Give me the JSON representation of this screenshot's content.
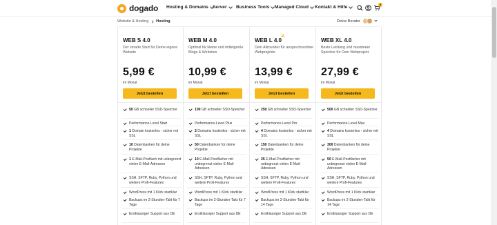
{
  "header": {
    "logo_text": "dogado",
    "nav": [
      {
        "label": "Hosting & Domains"
      },
      {
        "label": "Server"
      },
      {
        "label": "Business Tools"
      },
      {
        "label": "Managed Cloud"
      },
      {
        "label": "Kontakt & Hilfe"
      }
    ],
    "cart_count": "0"
  },
  "breadcrumb": {
    "items": [
      "Website & Hosting",
      "Hosting"
    ]
  },
  "advisor": {
    "label": "Deine Berater"
  },
  "plans": [
    {
      "name": "WEB S 4.0",
      "subtitle": "Der smarte Start für Deine eigene Website",
      "price": "5,99 €",
      "period": "im Monat",
      "cta": "Jetzt bestellen",
      "features": [
        {
          "strong": "50",
          "rest": " GB schneller SSD-Speicher"
        },
        {
          "strong": "",
          "rest": "Performance-Level Start"
        },
        {
          "strong": "1",
          "rest": " Domain kostenlos - sicher mit SSL"
        },
        {
          "strong": "10",
          "rest": " Datenbanken für deine Projekte"
        },
        {
          "strong": "1",
          "rest": " E-Mail-Postfach mit unbegrenzt vielen E-Mail-Adressen"
        },
        {
          "strong": "",
          "rest": "SSH, SFTP, Ruby, Python und weitere Profi-Features"
        },
        {
          "strong": "",
          "rest": "WordPress mit 1 Klick startklar"
        },
        {
          "strong": "",
          "rest": "Backups im 2-Stunden-Takt für 7 Tage"
        },
        {
          "strong": "",
          "rest": "Erstklassiger Support aus DE"
        }
      ]
    },
    {
      "name": "WEB M 4.0",
      "subtitle": "Optimal für kleine und mittelgroße Blogs & Websites",
      "price": "10,99 €",
      "period": "im Monat",
      "cta": "Jetzt bestellen",
      "features": [
        {
          "strong": "100",
          "rest": " GB schneller SSD-Speicher"
        },
        {
          "strong": "",
          "rest": "Performance-Level Plus"
        },
        {
          "strong": "2",
          "rest": " Domains kostenlos - sicher mit SSL"
        },
        {
          "strong": "50",
          "rest": " Datenbanken für deine Projekte"
        },
        {
          "strong": "10",
          "rest": " E-Mail-Postfächer mit unbegrenzt vielen E-Mail-Adressen"
        },
        {
          "strong": "",
          "rest": "SSH, SFTP, Ruby, Python und weitere Profi-Features"
        },
        {
          "strong": "",
          "rest": "WordPress mit 1 Klick startklar"
        },
        {
          "strong": "",
          "rest": "Backups im 2-Stunden-Takt für 7 Tage"
        },
        {
          "strong": "",
          "rest": "Erstklassiger Support aus DE"
        }
      ]
    },
    {
      "name": "WEB L 4.0",
      "subtitle": "Dein Allrounder für anspruchsvollste Webprojekte",
      "price": "13,99 €",
      "period": "im Monat",
      "cta": "Jetzt bestellen",
      "features": [
        {
          "strong": "250",
          "rest": " GB schneller SSD-Speicher"
        },
        {
          "strong": "",
          "rest": "Performance-Level Pro"
        },
        {
          "strong": "4",
          "rest": " Domains kostenlos - sicher mit SSL"
        },
        {
          "strong": "150",
          "rest": " Datenbanken für deine Projekte"
        },
        {
          "strong": "25",
          "rest": " E-Mail-Postfächer mit unbegrenzt vielen E-Mail-Adressen"
        },
        {
          "strong": "",
          "rest": "SSH, SFTP, Ruby, Python und weitere Profi-Features"
        },
        {
          "strong": "",
          "rest": "WordPress mit 1 Klick startklar"
        },
        {
          "strong": "",
          "rest": "Backups im 2-Stunden-Takt für 14 Tage"
        },
        {
          "strong": "",
          "rest": "Erstklassiger Support aus DE"
        }
      ]
    },
    {
      "name": "WEB XL 4.0",
      "subtitle": "Beste Leistung und maximaler Speicher für Dein Webprojekt",
      "price": "27,99 €",
      "period": "im Monat",
      "cta": "Jetzt bestellen",
      "features": [
        {
          "strong": "500",
          "rest": " GB schneller SSD-Speicher"
        },
        {
          "strong": "",
          "rest": "Performance-Level Max"
        },
        {
          "strong": "4",
          "rest": " Domains kostenlos - sicher mit SSL"
        },
        {
          "strong": "300",
          "rest": " Datenbanken für deine Projekte"
        },
        {
          "strong": "50",
          "rest": " E-Mail-Postfächer mit unbegrenzt vielen E-Mail-Adressen"
        },
        {
          "strong": "",
          "rest": "SSH, SFTP, Ruby, Python und weitere Profi-Features"
        },
        {
          "strong": "",
          "rest": "WordPress mit 1 Klick startklar"
        },
        {
          "strong": "",
          "rest": "Backups im 2-Stunden-Takt für 14 Tage"
        },
        {
          "strong": "",
          "rest": "Erstklassiger Support aus DE"
        }
      ]
    }
  ],
  "colors": {
    "accent": "#f5b91d",
    "logo": "#f5a623"
  }
}
